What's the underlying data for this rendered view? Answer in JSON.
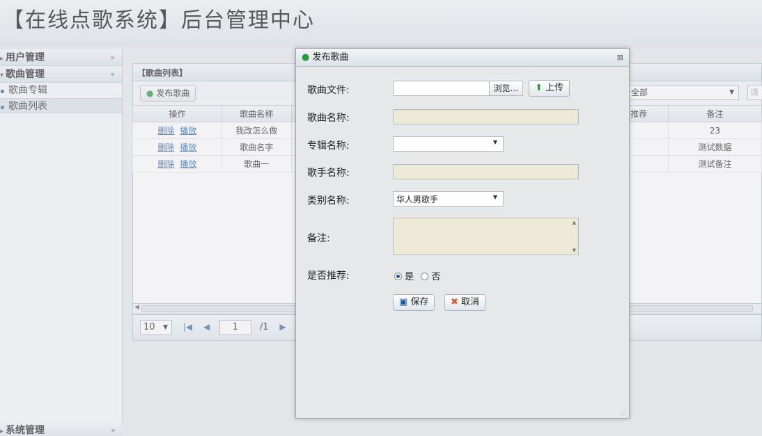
{
  "app": {
    "title": "【在线点歌系统】后台管理中心"
  },
  "sidebar": {
    "groups": [
      {
        "label": "用户管理",
        "arrow": "»",
        "expanded": false
      },
      {
        "label": "歌曲管理",
        "arrow": "«",
        "expanded": true
      },
      {
        "label": "系统管理",
        "arrow": "»",
        "expanded": false
      }
    ],
    "items": [
      {
        "label": "歌曲专辑",
        "selected": false
      },
      {
        "label": "歌曲列表",
        "selected": true
      }
    ]
  },
  "main": {
    "panel_title": "【歌曲列表】",
    "toolbar": {
      "publish_label": "发布歌曲",
      "filter_value": "全部",
      "search_placeholder": "请"
    },
    "table": {
      "columns": [
        "操作",
        "歌曲名称",
        "推荐",
        "备注"
      ],
      "rows": [
        {
          "delete": "删除",
          "play": "播放",
          "name": "我改怎么做",
          "note": "23"
        },
        {
          "delete": "删除",
          "play": "播放",
          "name": "歌曲名字",
          "note": "测试数据"
        },
        {
          "delete": "删除",
          "play": "播放",
          "name": "歌曲一",
          "note": "测试备注"
        }
      ]
    },
    "pager": {
      "page_size": "10",
      "current_page": "1",
      "total_pages": "/1"
    }
  },
  "dialog": {
    "title": "发布歌曲",
    "labels": {
      "file": "歌曲文件:",
      "song_name": "歌曲名称:",
      "album": "专辑名称:",
      "singer": "歌手名称:",
      "category": "类别名称:",
      "note": "备注:",
      "recommend": "是否推荐:"
    },
    "browse_label": "浏览...",
    "upload_label": "上传",
    "category_value": "华人男歌手",
    "recommend_yes": "是",
    "recommend_no": "否",
    "save_label": "保存",
    "cancel_label": "取消"
  }
}
